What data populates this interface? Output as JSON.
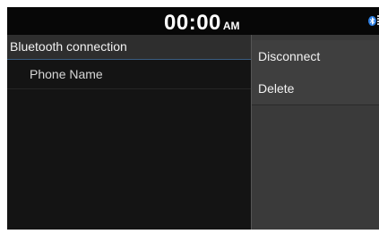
{
  "status_bar": {
    "time": "00:00",
    "ampm": "AM",
    "bluetooth_icon": "bluetooth-icon",
    "signal_icon": "signal-bars-icon"
  },
  "list": {
    "header": "Bluetooth connection",
    "items": [
      {
        "label": "Phone Name"
      }
    ]
  },
  "popup_menu": {
    "items": [
      {
        "label": "Disconnect"
      },
      {
        "label": "Delete"
      }
    ]
  },
  "colors": {
    "background": "#141414",
    "status_bar": "#070707",
    "header_bg": "#2e2e2e",
    "header_divider": "#3b5e82",
    "popup_bg": "#3a3a3a",
    "bluetooth_accent": "#2b7de0"
  }
}
